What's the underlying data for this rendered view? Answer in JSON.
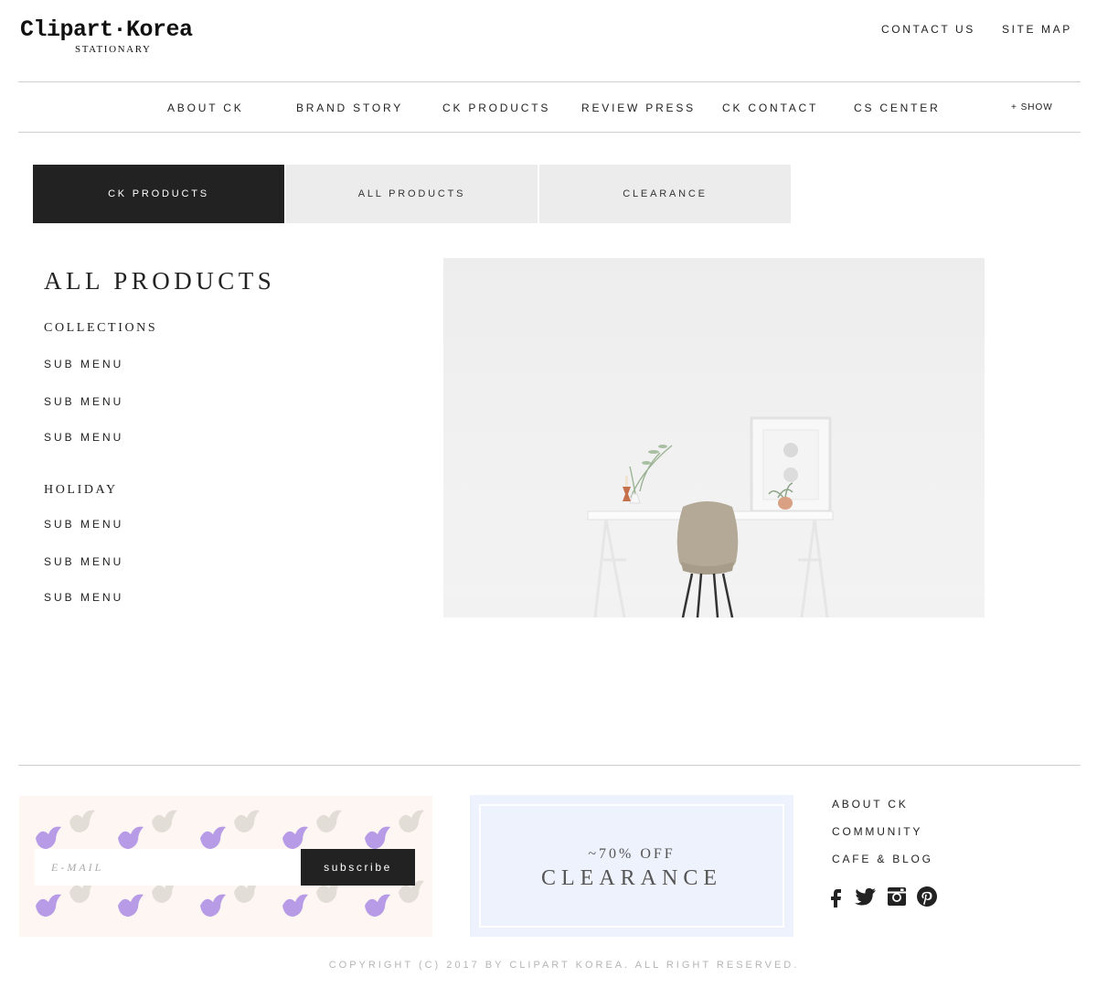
{
  "logo": {
    "title": "Clipart·Korea",
    "subtitle": "STATIONARY"
  },
  "top_links": {
    "contact": "CONTACT US",
    "sitemap": "SITE MAP"
  },
  "nav": {
    "items": [
      "ABOUT CK",
      "BRAND STORY",
      "CK PRODUCTS",
      "REVIEW PRESS",
      "CK CONTACT",
      "CS CENTER"
    ],
    "show_label": "+ SHOW"
  },
  "tabs": [
    {
      "label": "CK PRODUCTS",
      "active": true
    },
    {
      "label": "ALL PRODUCTS",
      "active": false
    },
    {
      "label": "CLEARANCE",
      "active": false
    }
  ],
  "sidebar": {
    "title": "ALL PRODUCTS",
    "sections": [
      {
        "heading": "COLLECTIONS",
        "items": [
          "SUB MENU",
          "SUB MENU",
          "SUB MENU"
        ]
      },
      {
        "heading": "HOLIDAY",
        "items": [
          "SUB MENU",
          "SUB MENU",
          "SUB MENU"
        ]
      }
    ]
  },
  "footer": {
    "subscribe": {
      "placeholder": "E-MAIL",
      "button": "subscribe"
    },
    "clearance": {
      "offer": "~70% OFF",
      "title": "CLEARANCE"
    },
    "links": [
      "ABOUT CK",
      "COMMUNITY",
      "CAFE & BLOG"
    ],
    "social_icons": [
      "facebook-icon",
      "twitter-icon",
      "instagram-icon",
      "pinterest-icon"
    ],
    "copyright": "COPYRIGHT (C) 2017 BY CLIPART KOREA. ALL RIGHT RESERVED."
  },
  "colors": {
    "dark": "#222222",
    "tab_inactive": "#ececec",
    "subscribe_bg": "#fdf6f2",
    "clearance_bg": "#eef2fc",
    "bird_purple": "#b79be6",
    "bird_grey": "#e3ddd8"
  }
}
